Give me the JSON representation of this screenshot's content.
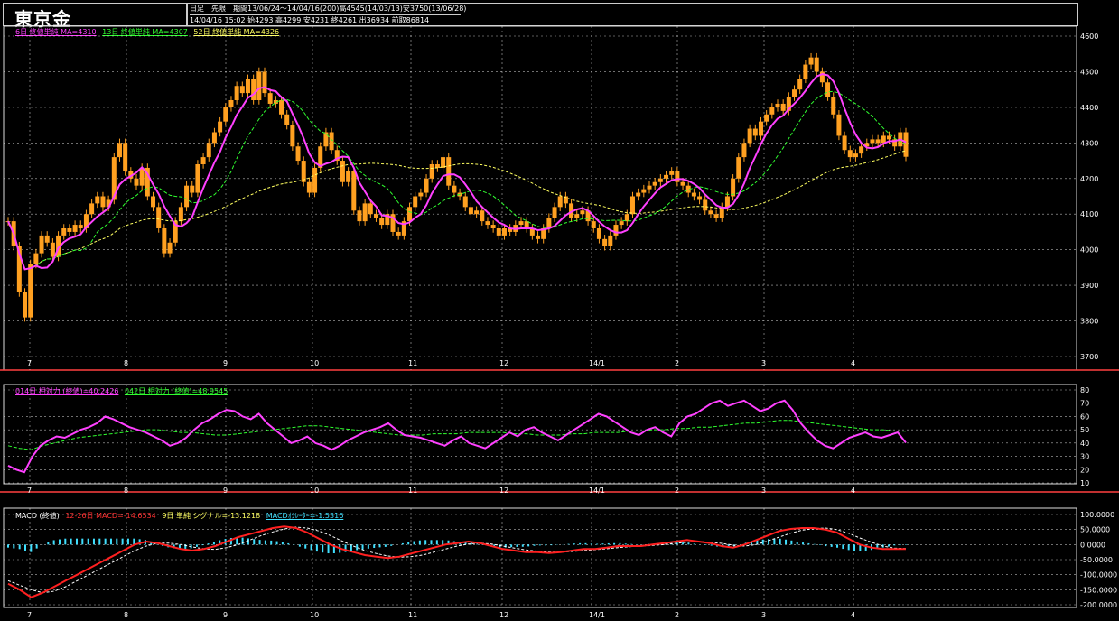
{
  "header": {
    "title": "東京金",
    "info_line1": "日足　先限　期間13/06/24～14/04/16(200)高4545(14/03/13)安3750(13/06/28)",
    "info_line2": "14/04/16 15:02 始4293 高4299 安4231 終4261 出36934 前取86814"
  },
  "legends": {
    "price": [
      {
        "text": "6日 終値単純 MA=4310",
        "color": "#ff40ff"
      },
      {
        "text": "13日 終値単純 MA=4307",
        "color": "#30ff30"
      },
      {
        "text": "52日 終値単純 MA=4326",
        "color": "#ffff60"
      }
    ],
    "rsi": [
      {
        "text": "014日 相対力 (終値)=40.2426",
        "color": "#ff40ff"
      },
      {
        "text": "042日 相対力 (終値)=48.9545",
        "color": "#30ff30"
      }
    ],
    "macd": [
      {
        "text": "MACD (終値)",
        "color": "#ffffff"
      },
      {
        "text": "12-26日 MACD=-14.6534",
        "color": "#ff3030"
      },
      {
        "text": "9日 単純 シグナル=-13.1218",
        "color": "#ffff60"
      },
      {
        "text": "MACDｵｼﾚｰﾀｰ=-1.5316",
        "color": "#40e0ff"
      }
    ]
  },
  "colors": {
    "candle": "#ffa020",
    "ma6": "#ff40ff",
    "ma13": "#30ff30",
    "ma52": "#ffff60",
    "macd": "#ff2020",
    "signal": "#ffffff",
    "histogram": "#40e0ff",
    "panel_border": "#ff4040",
    "grid": "#ffffff"
  },
  "chart_data": [
    {
      "type": "candlestick",
      "title": "東京金",
      "x_labels": [
        "7",
        "8",
        "9",
        "10",
        "11",
        "12",
        "14/1",
        "2",
        "3",
        "4"
      ],
      "y_ticks": [
        3700,
        3800,
        3900,
        4000,
        4100,
        4200,
        4300,
        4400,
        4500,
        4600
      ],
      "ylim": [
        3700,
        4600
      ],
      "grid": true,
      "close_series": [
        4080,
        4010,
        3880,
        3810,
        3960,
        3990,
        4040,
        4020,
        3980,
        4040,
        4060,
        4050,
        4070,
        4060,
        4100,
        4130,
        4150,
        4120,
        4140,
        4260,
        4300,
        4220,
        4200,
        4180,
        4230,
        4150,
        4120,
        4060,
        3990,
        4020,
        4080,
        4120,
        4180,
        4160,
        4240,
        4260,
        4300,
        4330,
        4360,
        4400,
        4420,
        4460,
        4440,
        4480,
        4420,
        4500,
        4440,
        4410,
        4420,
        4380,
        4350,
        4290,
        4250,
        4190,
        4160,
        4230,
        4290,
        4330,
        4280,
        4250,
        4190,
        4220,
        4110,
        4080,
        4130,
        4100,
        4090,
        4070,
        4100,
        4050,
        4040,
        4080,
        4120,
        4150,
        4160,
        4200,
        4240,
        4230,
        4260,
        4180,
        4160,
        4150,
        4120,
        4100,
        4110,
        4080,
        4070,
        4060,
        4040,
        4060,
        4050,
        4070,
        4080,
        4060,
        4040,
        4030,
        4060,
        4090,
        4120,
        4150,
        4130,
        4090,
        4100,
        4110,
        4080,
        4060,
        4030,
        4010,
        4040,
        4070,
        4080,
        4100,
        4150,
        4160,
        4170,
        4180,
        4190,
        4200,
        4210,
        4220,
        4190,
        4180,
        4160,
        4150,
        4140,
        4110,
        4100,
        4090,
        4120,
        4150,
        4200,
        4260,
        4300,
        4340,
        4320,
        4360,
        4380,
        4400,
        4410,
        4390,
        4430,
        4450,
        4480,
        4520,
        4540,
        4500,
        4470,
        4430,
        4380,
        4320,
        4280,
        4260,
        4270,
        4290,
        4300,
        4310,
        4300,
        4320,
        4310,
        4290,
        4330,
        4261
      ],
      "ma6_value": 4310,
      "ma13_value": 4307,
      "ma52_value": 4326
    },
    {
      "type": "line",
      "title": "相対力",
      "x_labels": [
        "7",
        "8",
        "9",
        "10",
        "11",
        "12",
        "14/1",
        "2",
        "3",
        "4"
      ],
      "y_ticks": [
        10,
        20,
        30,
        40,
        50,
        60,
        70,
        80
      ],
      "ylim": [
        10,
        80
      ],
      "series": [
        {
          "name": "014日 相対力 (終値)",
          "last": 40.2426,
          "values": [
            23,
            20,
            18,
            30,
            38,
            42,
            45,
            44,
            47,
            50,
            52,
            55,
            60,
            58,
            55,
            52,
            50,
            48,
            45,
            42,
            38,
            40,
            44,
            50,
            55,
            58,
            62,
            65,
            64,
            60,
            58,
            62,
            55,
            50,
            45,
            40,
            42,
            45,
            40,
            38,
            35,
            38,
            42,
            45,
            48,
            50,
            52,
            55,
            50,
            46,
            45,
            44,
            42,
            40,
            38,
            42,
            45,
            40,
            38,
            36,
            40,
            44,
            48,
            45,
            50,
            52,
            48,
            45,
            42,
            46,
            50,
            54,
            58,
            62,
            60,
            56,
            52,
            48,
            46,
            50,
            52,
            48,
            45,
            55,
            60,
            62,
            66,
            70,
            72,
            68,
            70,
            72,
            68,
            64,
            66,
            70,
            72,
            65,
            55,
            48,
            42,
            38,
            36,
            40,
            44,
            46,
            48,
            45,
            44,
            46,
            48,
            40.24
          ]
        },
        {
          "name": "042日 相対力 (終値)",
          "last": 48.9545,
          "values": [
            38,
            36,
            35,
            38,
            40,
            42,
            44,
            45,
            46,
            47,
            48,
            49,
            50,
            50,
            49,
            48,
            48,
            47,
            46,
            46,
            47,
            48,
            49,
            50,
            51,
            52,
            53,
            53,
            52,
            51,
            50,
            49,
            48,
            47,
            46,
            46,
            46,
            47,
            47,
            47,
            48,
            48,
            48,
            48,
            47,
            47,
            46,
            46,
            46,
            47,
            47,
            48,
            48,
            48,
            49,
            49,
            50,
            50,
            51,
            51,
            52,
            52,
            53,
            54,
            55,
            55,
            56,
            57,
            57,
            56,
            55,
            54,
            53,
            52,
            51,
            50,
            50,
            49,
            48.95
          ]
        }
      ]
    },
    {
      "type": "line",
      "title": "MACD (終値)",
      "x_labels": [
        "7",
        "8",
        "9",
        "10",
        "11",
        "12",
        "14/1",
        "2",
        "3",
        "4"
      ],
      "y_ticks": [
        100,
        50,
        0,
        -50,
        -100,
        -150,
        -200
      ],
      "ylim": [
        -200,
        100
      ],
      "series": [
        {
          "name": "12-26日 MACD",
          "last": -14.6534,
          "values": [
            -130,
            -150,
            -175,
            -160,
            -140,
            -120,
            -100,
            -80,
            -60,
            -40,
            -20,
            0,
            10,
            5,
            -5,
            -15,
            -20,
            -15,
            -5,
            10,
            25,
            35,
            45,
            55,
            60,
            55,
            40,
            20,
            0,
            -15,
            -25,
            -35,
            -40,
            -45,
            -40,
            -30,
            -20,
            -10,
            0,
            5,
            10,
            5,
            -5,
            -15,
            -20,
            -25,
            -25,
            -28,
            -25,
            -20,
            -15,
            -15,
            -10,
            -5,
            -5,
            -5,
            0,
            5,
            10,
            15,
            10,
            5,
            -5,
            -10,
            0,
            15,
            30,
            45,
            52,
            55,
            55,
            50,
            40,
            20,
            0,
            -10,
            -15,
            -15,
            -14.65
          ]
        },
        {
          "name": "9日 単純 シグナル",
          "last": -13.1218,
          "values": [
            -120,
            -135,
            -150,
            -160,
            -155,
            -140,
            -120,
            -100,
            -80,
            -60,
            -40,
            -20,
            -5,
            5,
            5,
            0,
            -8,
            -14,
            -16,
            -10,
            0,
            15,
            30,
            42,
            52,
            58,
            55,
            45,
            30,
            12,
            -5,
            -20,
            -30,
            -38,
            -42,
            -40,
            -35,
            -25,
            -15,
            -5,
            2,
            5,
            2,
            -5,
            -12,
            -18,
            -22,
            -25,
            -25,
            -23,
            -20,
            -17,
            -14,
            -10,
            -7,
            -5,
            -3,
            0,
            4,
            8,
            10,
            8,
            4,
            -2,
            -5,
            0,
            12,
            25,
            38,
            48,
            53,
            55,
            50,
            38,
            22,
            8,
            -5,
            -12,
            -13.12
          ]
        },
        {
          "name": "MACDｵｼﾚｰﾀｰ",
          "last": -1.5316,
          "values": [
            -10,
            -15,
            -25,
            0,
            15,
            20,
            20,
            20,
            20,
            20,
            20,
            20,
            15,
            0,
            -10,
            -15,
            -12,
            -1,
            11,
            20,
            25,
            20,
            15,
            13,
            8,
            -3,
            -15,
            -25,
            -30,
            -27,
            -20,
            -15,
            -10,
            -7,
            2,
            10,
            15,
            15,
            15,
            10,
            8,
            0,
            -7,
            -10,
            -8,
            -7,
            -3,
            -3,
            0,
            3,
            5,
            2,
            4,
            5,
            2,
            0,
            3,
            5,
            6,
            7,
            0,
            -3,
            -9,
            -8,
            5,
            15,
            18,
            20,
            14,
            7,
            2,
            -5,
            -10,
            -18,
            -22,
            -18,
            -10,
            -3,
            -1.53
          ]
        }
      ]
    }
  ]
}
